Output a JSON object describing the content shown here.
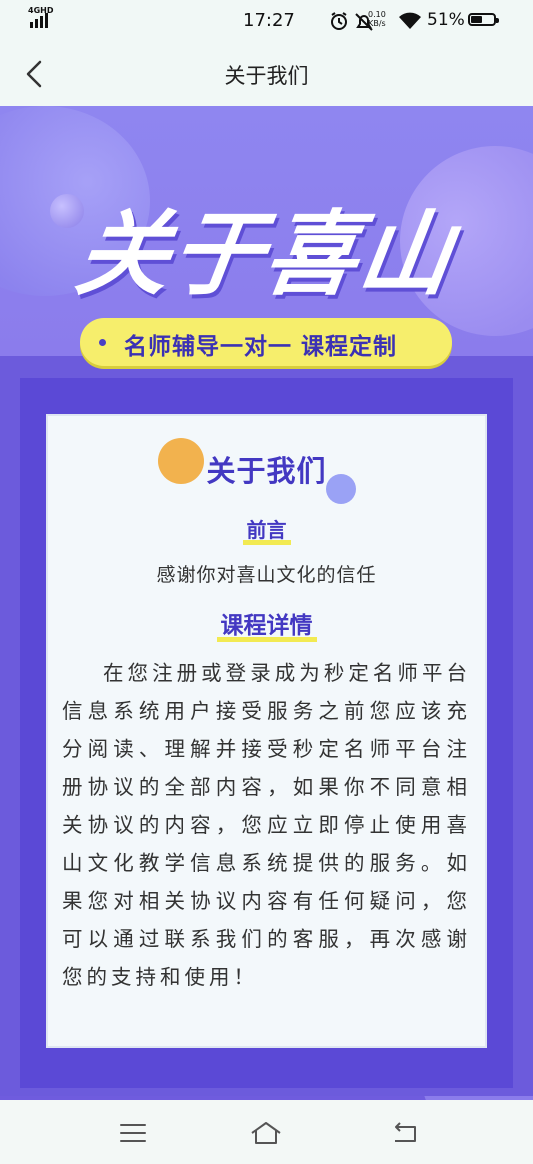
{
  "status_bar": {
    "network": "4GHD",
    "time": "17:27",
    "speed_value": "0.10",
    "speed_unit": "KB/s",
    "battery": "51%",
    "battery_level": 0.51
  },
  "nav": {
    "title": "关于我们"
  },
  "banner": {
    "headline": "关于喜山",
    "tagline": "名师辅导一对一 课程定制"
  },
  "card": {
    "title": "关于我们",
    "section1_label": "前言",
    "intro": "感谢你对喜山文化的信任",
    "section2_label": "课程详情",
    "body": "在您注册或登录成为秒定名师平台信息系统用户接受服务之前您应该充分阅读、理解并接受秒定名师平台注册协议的全部内容，如果你不同意相关协议的内容，您应立即停止使用喜山文化教学信息系统提供的服务。如果您对相关协议内容有任何疑问，您可以通过联系我们的客服，再次感谢您的支持和使用！"
  },
  "bottom_nav": {
    "icons": [
      "menu-icon",
      "home-icon",
      "back-icon"
    ]
  }
}
